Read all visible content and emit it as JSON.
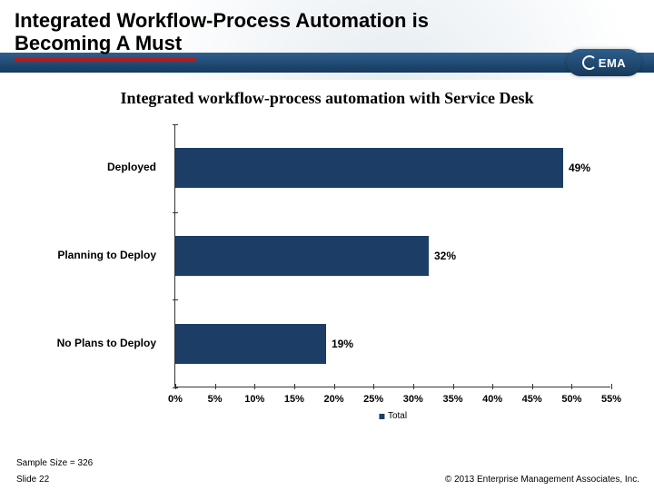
{
  "header": {
    "title_line1": "Integrated Workflow-Process Automation is",
    "title_line2": "Becoming A Must",
    "logo_text": "EMA"
  },
  "chart_data": {
    "type": "bar",
    "orientation": "horizontal",
    "title": "Integrated workflow-process automation with Service Desk",
    "categories": [
      "Deployed",
      "Planning to Deploy",
      "No Plans to Deploy"
    ],
    "series": [
      {
        "name": "Total",
        "values": [
          49,
          32,
          19
        ]
      }
    ],
    "xlabel": "",
    "ylabel": "",
    "xticks": [
      0,
      5,
      10,
      15,
      20,
      25,
      30,
      35,
      40,
      45,
      50,
      55
    ],
    "xlim": [
      0,
      55
    ],
    "value_labels": [
      "49%",
      "32%",
      "19%"
    ],
    "tick_labels": [
      "0%",
      "5%",
      "10%",
      "15%",
      "20%",
      "25%",
      "30%",
      "35%",
      "40%",
      "45%",
      "50%",
      "55%"
    ],
    "legend": "Total",
    "bar_color": "#1c3e66"
  },
  "footer": {
    "sample_size": "Sample Size = 326",
    "slide": "Slide 22",
    "copyright": "© 2013 Enterprise Management Associates, Inc."
  }
}
